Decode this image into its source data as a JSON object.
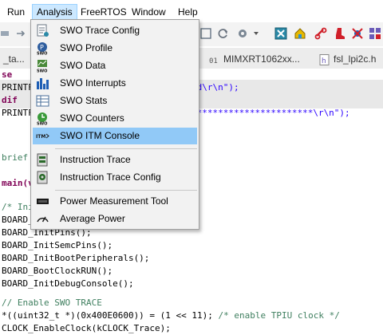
{
  "menubar": {
    "items": [
      "Run",
      "Analysis",
      "FreeRTOS",
      "Window",
      "Help"
    ]
  },
  "tabs": [
    {
      "label": "_ta..."
    },
    {
      "label": "MIMXRT1062xx..."
    },
    {
      "label": "fsl_lpi2c.h"
    }
  ],
  "menu": {
    "items": [
      {
        "label": "SWO Trace Config",
        "icon": "swo-trace-config-icon"
      },
      {
        "label": "SWO Profile",
        "icon": "swo-profile-icon"
      },
      {
        "label": "SWO Data",
        "icon": "swo-data-icon"
      },
      {
        "label": "SWO Interrupts",
        "icon": "swo-interrupts-icon"
      },
      {
        "label": "SWO Stats",
        "icon": "swo-stats-icon"
      },
      {
        "label": "SWO Counters",
        "icon": "swo-counters-icon"
      },
      {
        "label": "SWO ITM Console",
        "icon": "swo-itm-console-icon"
      },
      {
        "label": "Instruction Trace",
        "icon": "instruction-trace-icon"
      },
      {
        "label": "Instruction Trace Config",
        "icon": "instruction-trace-config-icon"
      },
      {
        "label": "Power Measurement Tool",
        "icon": "power-measurement-icon"
      },
      {
        "label": "Average Power",
        "icon": "average-power-icon"
      }
    ],
    "highlighted": "SWO ITM Console"
  },
  "code": {
    "l1": "se",
    "l2a": "PRINTF",
    "l2b": "rd\\r\\n\");",
    "l3": "dif",
    "l4a": "PRINTF",
    "l4b": "***********************\\r\\n\");",
    "l5": "brief",
    "l6": "main(v",
    "l7": "/* Ini",
    "l8": "BOARD_",
    "l9": "BOARD_InitPins();",
    "l10": "BOARD_InitSemcPins();",
    "l11": "BOARD_InitBootPeripherals();",
    "l12": "BOARD_BootClockRUN();",
    "l13": "BOARD_InitDebugConsole();",
    "l14": "// Enable SWO TRACE",
    "l15a": "*((uint32_t *)(0x400E0600)) = (1 << 11);",
    "l15b": " /* enable TPIU clock */",
    "l16": "CLOCK_EnableClock(kCLOCK_Trace);"
  }
}
